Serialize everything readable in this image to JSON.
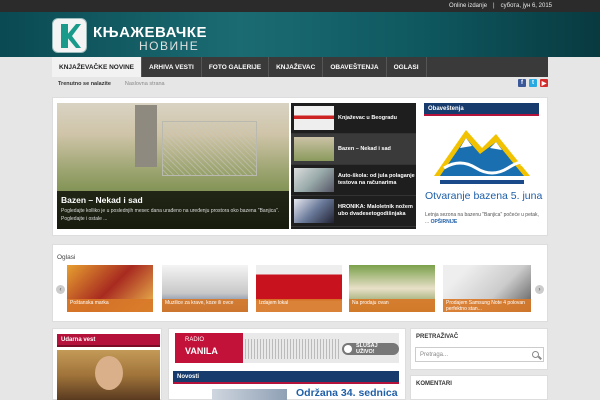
{
  "topbar": {
    "online": "Online izdanje",
    "sep": "|",
    "date": "субота, јун 6, 2015"
  },
  "header": {
    "title": "КЊАЖЕВАЧКЕ",
    "subtitle": "НОВИНЕ"
  },
  "nav": {
    "items": [
      "KNJAŽEVAČKE NOVINE",
      "ARHIVA VESTI",
      "FOTO GALERIJE",
      "KNJAŽEVAC",
      "OBAVEŠTENJA",
      "OGLASI"
    ]
  },
  "breadcrumb": {
    "location_label": "Trenutno se nalazite",
    "current": "Naslovna strana"
  },
  "social": {
    "facebook": "f",
    "twitter": "t",
    "youtube": "▶"
  },
  "slider": {
    "title": "Bazen – Nekad i sad",
    "text": "Pogledajte kolliko je u poslednjih mesec dana urađeno na uređenju prostora oko bazena \"Banjica\". Pogledajte i ostale ..."
  },
  "side_list": [
    {
      "label": "Knjaževac u Beogradu"
    },
    {
      "label": "Bazen – Nekad i sad"
    },
    {
      "label": "Auto-škola: od jula polaganje testova na računarima"
    },
    {
      "label": "HRONIKA: Maloletnik nožem ubo dvadesetogodišnjaka"
    }
  ],
  "notices": {
    "header": "Obaveštenja",
    "title": "Otvaranje bazena 5. juna",
    "text": "Letnja sezona na bazenu \"Banjica\" počeće u petak, ...",
    "more": "OPŠIRNIJE"
  },
  "ads": {
    "label": "Oglasi",
    "prev": "‹",
    "next": "›",
    "items": [
      {
        "caption": "Poštanska marka"
      },
      {
        "caption": "Muzilice za krave, koze ili ovce"
      },
      {
        "caption": "Izdajem lokal"
      },
      {
        "caption": "Na prodaju ovan"
      },
      {
        "caption": "Prodajem Samsung Note 4 polovan perfektno stan..."
      }
    ]
  },
  "breaking": {
    "header": "Udarna vest"
  },
  "radio": {
    "line1": "RADIO",
    "line2": "VANILA",
    "listen": "SLUŠAJ UŽIVO!"
  },
  "news": {
    "header": "Novosti",
    "headline": "Održana 34. sednica"
  },
  "search": {
    "header": "PRETRAŽIVAČ",
    "placeholder": "Pretraga..."
  },
  "comments": {
    "header": "KOMENTARI"
  }
}
